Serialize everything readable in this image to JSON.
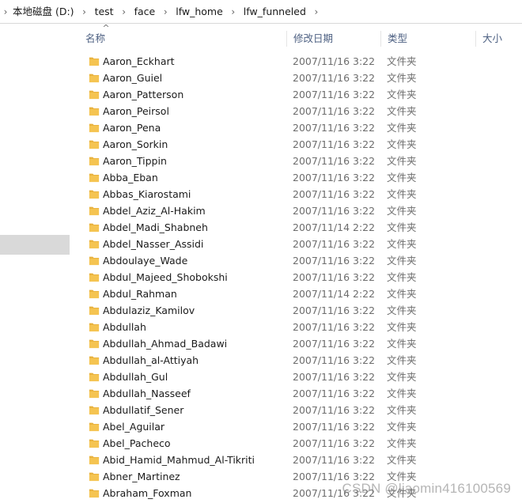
{
  "breadcrumb": {
    "items": [
      "本地磁盘 (D:)",
      "test",
      "face",
      "lfw_home",
      "lfw_funneled"
    ],
    "separator": "›"
  },
  "columns": {
    "name": "名称",
    "date": "修改日期",
    "type": "类型",
    "size": "大小",
    "sort_indicator": "^"
  },
  "colors": {
    "folder": "#f5c451",
    "folder_tab": "#e8b13c",
    "header_text": "#4d6082",
    "nav_selected": "#d9d9d9"
  },
  "files": [
    {
      "name": "Aaron_Eckhart",
      "date": "2007/11/16 3:22",
      "type": "文件夹"
    },
    {
      "name": "Aaron_Guiel",
      "date": "2007/11/16 3:22",
      "type": "文件夹"
    },
    {
      "name": "Aaron_Patterson",
      "date": "2007/11/16 3:22",
      "type": "文件夹"
    },
    {
      "name": "Aaron_Peirsol",
      "date": "2007/11/16 3:22",
      "type": "文件夹"
    },
    {
      "name": "Aaron_Pena",
      "date": "2007/11/16 3:22",
      "type": "文件夹"
    },
    {
      "name": "Aaron_Sorkin",
      "date": "2007/11/16 3:22",
      "type": "文件夹"
    },
    {
      "name": "Aaron_Tippin",
      "date": "2007/11/16 3:22",
      "type": "文件夹"
    },
    {
      "name": "Abba_Eban",
      "date": "2007/11/16 3:22",
      "type": "文件夹"
    },
    {
      "name": "Abbas_Kiarostami",
      "date": "2007/11/16 3:22",
      "type": "文件夹"
    },
    {
      "name": "Abdel_Aziz_Al-Hakim",
      "date": "2007/11/16 3:22",
      "type": "文件夹"
    },
    {
      "name": "Abdel_Madi_Shabneh",
      "date": "2007/11/14 2:22",
      "type": "文件夹"
    },
    {
      "name": "Abdel_Nasser_Assidi",
      "date": "2007/11/16 3:22",
      "type": "文件夹"
    },
    {
      "name": "Abdoulaye_Wade",
      "date": "2007/11/16 3:22",
      "type": "文件夹"
    },
    {
      "name": "Abdul_Majeed_Shobokshi",
      "date": "2007/11/16 3:22",
      "type": "文件夹"
    },
    {
      "name": "Abdul_Rahman",
      "date": "2007/11/14 2:22",
      "type": "文件夹"
    },
    {
      "name": "Abdulaziz_Kamilov",
      "date": "2007/11/16 3:22",
      "type": "文件夹"
    },
    {
      "name": "Abdullah",
      "date": "2007/11/16 3:22",
      "type": "文件夹"
    },
    {
      "name": "Abdullah_Ahmad_Badawi",
      "date": "2007/11/16 3:22",
      "type": "文件夹"
    },
    {
      "name": "Abdullah_al-Attiyah",
      "date": "2007/11/16 3:22",
      "type": "文件夹"
    },
    {
      "name": "Abdullah_Gul",
      "date": "2007/11/16 3:22",
      "type": "文件夹"
    },
    {
      "name": "Abdullah_Nasseef",
      "date": "2007/11/16 3:22",
      "type": "文件夹"
    },
    {
      "name": "Abdullatif_Sener",
      "date": "2007/11/16 3:22",
      "type": "文件夹"
    },
    {
      "name": "Abel_Aguilar",
      "date": "2007/11/16 3:22",
      "type": "文件夹"
    },
    {
      "name": "Abel_Pacheco",
      "date": "2007/11/16 3:22",
      "type": "文件夹"
    },
    {
      "name": "Abid_Hamid_Mahmud_Al-Tikriti",
      "date": "2007/11/16 3:22",
      "type": "文件夹"
    },
    {
      "name": "Abner_Martinez",
      "date": "2007/11/16 3:22",
      "type": "文件夹"
    },
    {
      "name": "Abraham_Foxman",
      "date": "2007/11/16 3:22",
      "type": "文件夹"
    }
  ],
  "watermark": "CSDN @liaomin416100569"
}
